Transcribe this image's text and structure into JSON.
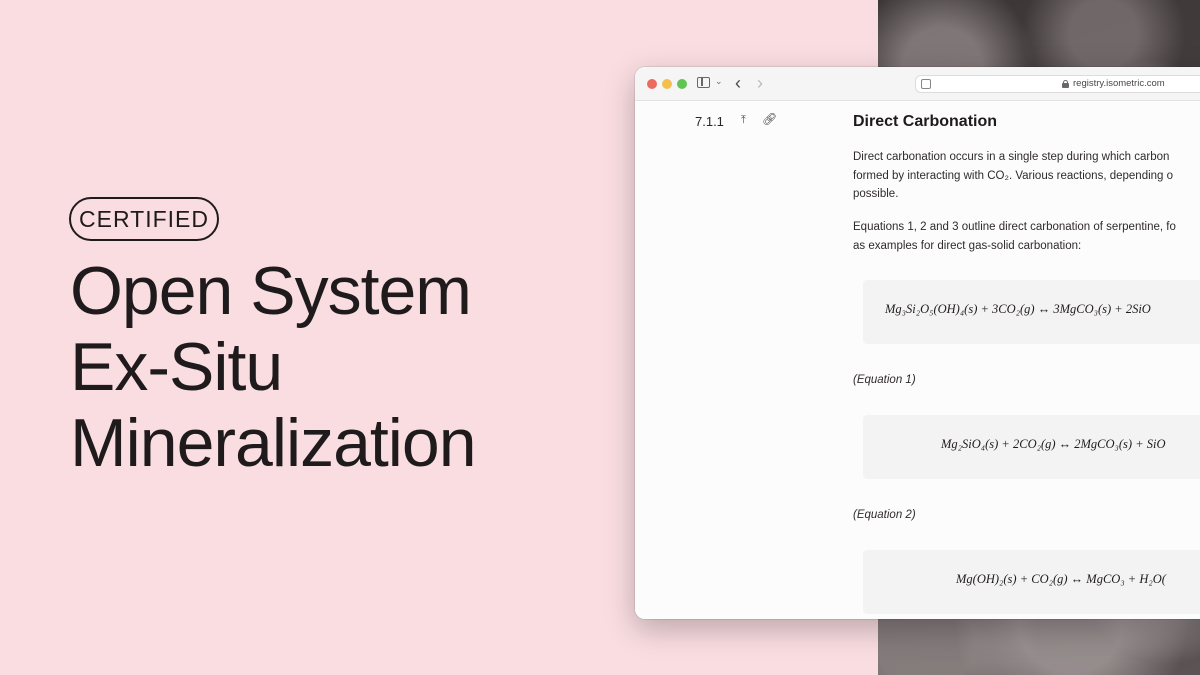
{
  "hero": {
    "badge": "CERTIFIED",
    "title_lines": [
      "Open System",
      "Ex-Situ",
      "Mineralization"
    ]
  },
  "browser": {
    "url": "registry.isometric.com"
  },
  "section": {
    "number": "7.1.1",
    "heading": "Direct Carbonation",
    "para1_lines": [
      "Direct carbonation occurs in a single step during which carbon",
      "formed by interacting with CO₂. Various reactions, depending o",
      "possible."
    ],
    "para2_lines": [
      "Equations 1, 2 and 3 outline direct carbonation of serpentine, fo",
      "as examples for direct gas-solid carbonation:"
    ],
    "equations": [
      {
        "formula": "Mg₃Si₂O₅(OH)₄(s) + 3CO₂(g) ↔ 3MgCO₃(s) + 2SiO",
        "label": "(Equation 1)"
      },
      {
        "formula": "Mg₂SiO₄(s) + 2CO₂(g) ↔ 2MgCO₃(s) + SiO",
        "label": "(Equation 2)"
      },
      {
        "formula": "Mg(OH)₂(s) + CO₂(g) ↔ MgCO₃ + H₂O(",
        "label": ""
      }
    ]
  },
  "colors": {
    "background": "#f9dde1",
    "text": "#1f1b1c"
  }
}
